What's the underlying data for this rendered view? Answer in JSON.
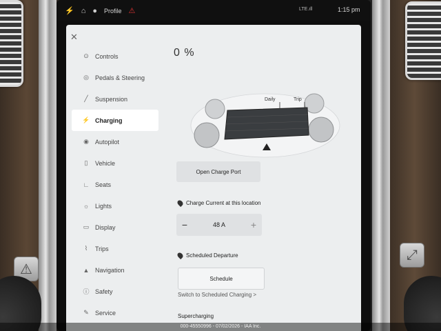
{
  "status_bar": {
    "profile_label": "Profile",
    "signal": "LTE.ıll",
    "time": "1:15 pm",
    "icons": [
      "lightning-icon",
      "home-icon",
      "person-icon",
      "warning-icon"
    ]
  },
  "menu": {
    "items": [
      {
        "label": "Controls",
        "icon": "car-icon"
      },
      {
        "label": "Pedals & Steering",
        "icon": "steering-icon"
      },
      {
        "label": "Suspension",
        "icon": "suspension-icon"
      },
      {
        "label": "Charging",
        "icon": "lightning-icon",
        "active": true
      },
      {
        "label": "Autopilot",
        "icon": "autopilot-icon"
      },
      {
        "label": "Vehicle",
        "icon": "vehicle-icon"
      },
      {
        "label": "Seats",
        "icon": "seat-icon"
      },
      {
        "label": "Lights",
        "icon": "light-icon"
      },
      {
        "label": "Display",
        "icon": "display-icon"
      },
      {
        "label": "Trips",
        "icon": "trips-icon"
      },
      {
        "label": "Navigation",
        "icon": "navigation-icon"
      },
      {
        "label": "Safety",
        "icon": "safety-icon"
      },
      {
        "label": "Service",
        "icon": "wrench-icon"
      }
    ]
  },
  "charging": {
    "percent": "0 %",
    "battery_level": 0,
    "limit_labels": {
      "daily": "Daily",
      "trip": "Trip"
    },
    "open_port_label": "Open Charge Port",
    "charge_current_title": "Charge Current at this location",
    "current_value": "48 A",
    "minus_label": "−",
    "plus_label": "+",
    "departure_title": "Scheduled Departure",
    "schedule_label": "Schedule",
    "switch_link": "Switch to Scheduled Charging >",
    "supercharging_title": "Supercharging"
  },
  "watermark": "000-45550996 - 07/02/2026 - IAA Inc."
}
